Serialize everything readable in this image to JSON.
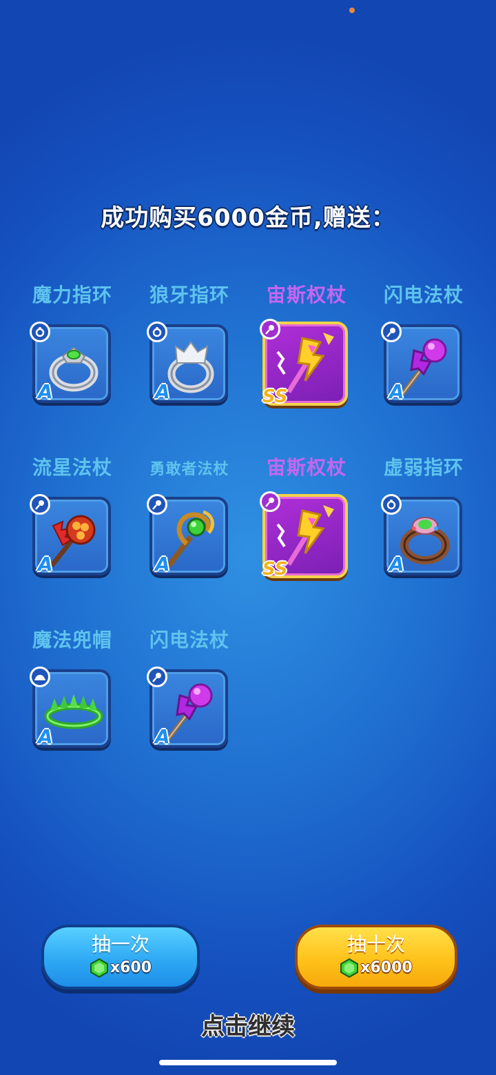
{
  "title": "成功购买6000金币,赠送：",
  "rewards": [
    {
      "name": "魔力指环",
      "grade": "A",
      "type": "ring",
      "rarity": "normal"
    },
    {
      "name": "狼牙指环",
      "grade": "A",
      "type": "ring",
      "rarity": "normal"
    },
    {
      "name": "宙斯权杖",
      "grade": "SS",
      "type": "staff",
      "rarity": "rare"
    },
    {
      "name": "闪电法杖",
      "grade": "A",
      "type": "staff",
      "rarity": "normal"
    },
    {
      "name": "流星法杖",
      "grade": "A",
      "type": "staff",
      "rarity": "normal"
    },
    {
      "name": "勇敢者法杖",
      "grade": "A",
      "type": "staff",
      "rarity": "normal"
    },
    {
      "name": "宙斯权杖",
      "grade": "SS",
      "type": "staff",
      "rarity": "rare"
    },
    {
      "name": "虚弱指环",
      "grade": "A",
      "type": "ring",
      "rarity": "normal"
    },
    {
      "name": "魔法兜帽",
      "grade": "A",
      "type": "hat",
      "rarity": "normal"
    },
    {
      "name": "闪电法杖",
      "grade": "A",
      "type": "staff",
      "rarity": "normal"
    }
  ],
  "buttons": {
    "draw_once": {
      "label": "抽一次",
      "cost": "x600"
    },
    "draw_ten": {
      "label": "抽十次",
      "cost": "x6000"
    }
  },
  "continue_label": "点击继续",
  "colors": {
    "name_normal": "#5ec3ee",
    "name_rare": "#c666f0",
    "grade_a": "#1e8ff0",
    "grade_ss": "#f3b21d"
  }
}
